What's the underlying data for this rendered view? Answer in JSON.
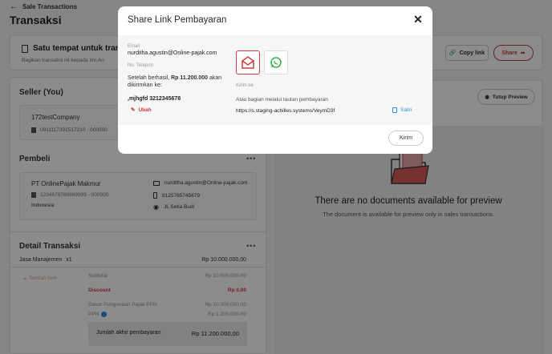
{
  "topbar": {
    "back_label": "Sale Transactions"
  },
  "page": {
    "title": "Transaksi"
  },
  "banner": {
    "title": "Satu tempat untuk tran",
    "subtitle": "Bagikan transaksi ini kepada tim An",
    "copy_label": "Copy link",
    "share_label": "Share"
  },
  "seller": {
    "title": "Seller (You)",
    "company": "172testCompany",
    "npwp": "0911117391517210 - 000000"
  },
  "buyer": {
    "title": "Pembeli",
    "company": "PT OnlinePajak Makmur",
    "npwp": "1234678788989999 - 000000",
    "country": "Indonesia",
    "email": "nurditha.agustin@Online-pajak.com",
    "phone": "8125765745679",
    "address": "JL Setia Budi"
  },
  "detail": {
    "title": "Detail Transaksi",
    "item_name": "Jasa Manajemen",
    "item_qty": "x1",
    "item_price": "Rp 10.000.000,00",
    "add_item": "Tambah Item",
    "subtotal_label": "Subtotal",
    "subtotal_value": "Rp 10.000.000,00",
    "discount_label": "Discount",
    "discount_value": "Rp 0,00",
    "dpp_label": "Dasar Pengenaan Pajak PPN",
    "dpp_value": "Rp 10.000.000,00",
    "ppn_label": "PPN",
    "ppn_value": "Rp 1.200.000,00",
    "total_label": "Jumlah akhir pembayaran",
    "total_value": "Rp 11.200.000,00"
  },
  "preview": {
    "close_label": "Tutup Preview",
    "empty_title": "There are no documents available for preview",
    "empty_sub": "The document is available for preview only in sales transactions."
  },
  "modal": {
    "title": "Share Link Pembayaran",
    "email_label": "Email",
    "email_value": "nurditha.agustin@Online-pajak.com",
    "phone_label": "No. Telepon",
    "after_text_1": "Setelah berhasil,",
    "amount": "Rp 11.200.000",
    "after_text_2": "akan",
    "after_text_3": "dikirimkan ke:",
    "recipient": ",mjhgfd 3212345678",
    "edit_label": "Ubah",
    "send_to_label": "Kirim ke",
    "link_hint": "Atau bagian melalui tautan pembayaran",
    "link_url": "https://s.staging-achilles.systems/VeymD3f",
    "copy_label": "Salin",
    "send_button": "Kirim"
  },
  "colors": {
    "accent_red": "#d23b3b",
    "whatsapp_green": "#2fb344",
    "link_blue": "#2f8fe0"
  }
}
